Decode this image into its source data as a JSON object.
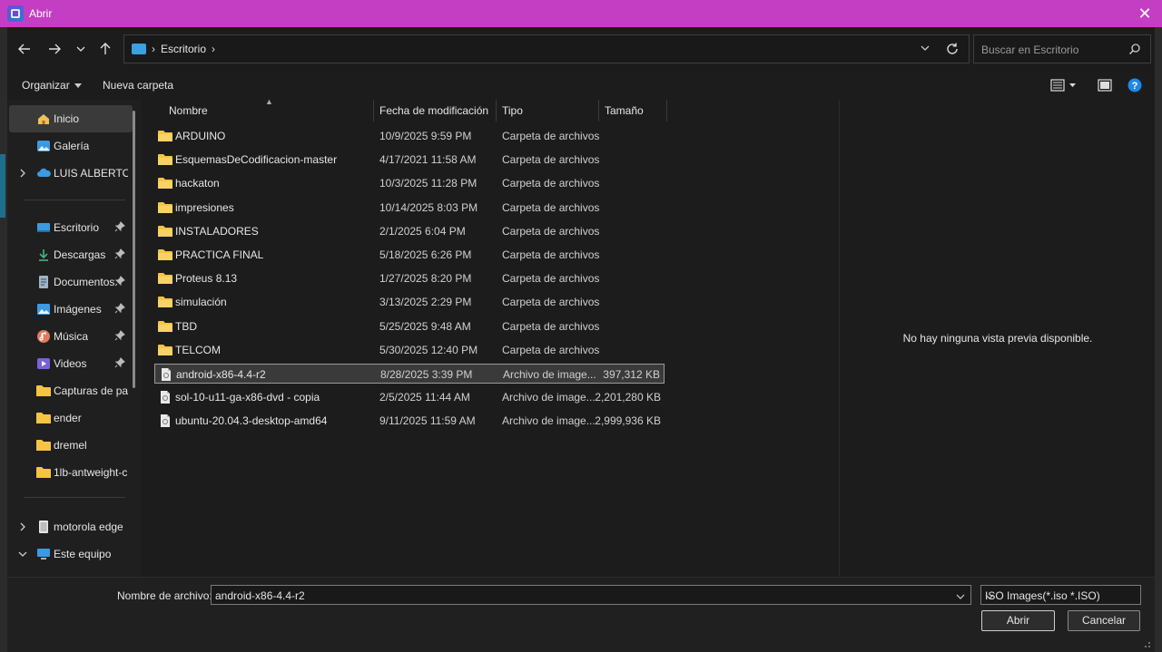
{
  "window": {
    "title": "Abrir"
  },
  "address": {
    "crumbs": [
      "Escritorio"
    ]
  },
  "search": {
    "placeholder": "Buscar en Escritorio"
  },
  "toolbar": {
    "organize_label": "Organizar",
    "new_folder_label": "Nueva carpeta"
  },
  "sidebar": {
    "items": [
      {
        "label": "Inicio",
        "icon": "home-icon"
      },
      {
        "label": "Galería",
        "icon": "gallery-icon"
      },
      {
        "label": "LUIS ALBERTO, I",
        "icon": "cloud-icon"
      },
      {
        "label": "Escritorio",
        "icon": "desktop-icon"
      },
      {
        "label": "Descargas",
        "icon": "download-icon"
      },
      {
        "label": "Documentos",
        "icon": "document-icon"
      },
      {
        "label": "Imágenes",
        "icon": "image-icon"
      },
      {
        "label": "Música",
        "icon": "music-icon"
      },
      {
        "label": "Videos",
        "icon": "video-icon"
      },
      {
        "label": "Capturas de par",
        "icon": "folder-icon"
      },
      {
        "label": "ender",
        "icon": "folder-icon"
      },
      {
        "label": "dremel",
        "icon": "folder-icon"
      },
      {
        "label": "1lb-antweight-c",
        "icon": "folder-icon"
      },
      {
        "label": "motorola edge",
        "icon": "phone-icon"
      },
      {
        "label": "Este equipo",
        "icon": "computer-icon"
      }
    ]
  },
  "columns": {
    "name": "Nombre",
    "date": "Fecha de modificación",
    "type": "Tipo",
    "size": "Tamaño"
  },
  "files": [
    {
      "name": "ARDUINO",
      "date": "10/9/2025 9:59 PM",
      "type": "Carpeta de archivos",
      "size": "",
      "kind": "folder"
    },
    {
      "name": "EsquemasDeCodificacion-master",
      "date": "4/17/2021 11:58 AM",
      "type": "Carpeta de archivos",
      "size": "",
      "kind": "folder"
    },
    {
      "name": "hackaton",
      "date": "10/3/2025 11:28 PM",
      "type": "Carpeta de archivos",
      "size": "",
      "kind": "folder"
    },
    {
      "name": "impresiones",
      "date": "10/14/2025 8:03 PM",
      "type": "Carpeta de archivos",
      "size": "",
      "kind": "folder"
    },
    {
      "name": "INSTALADORES",
      "date": "2/1/2025 6:04 PM",
      "type": "Carpeta de archivos",
      "size": "",
      "kind": "folder"
    },
    {
      "name": "PRACTICA FINAL",
      "date": "5/18/2025 6:26 PM",
      "type": "Carpeta de archivos",
      "size": "",
      "kind": "folder"
    },
    {
      "name": "Proteus 8.13",
      "date": "1/27/2025 8:20 PM",
      "type": "Carpeta de archivos",
      "size": "",
      "kind": "folder"
    },
    {
      "name": "simulación",
      "date": "3/13/2025 2:29 PM",
      "type": "Carpeta de archivos",
      "size": "",
      "kind": "folder"
    },
    {
      "name": "TBD",
      "date": "5/25/2025 9:48 AM",
      "type": "Carpeta de archivos",
      "size": "",
      "kind": "folder"
    },
    {
      "name": "TELCOM",
      "date": "5/30/2025 12:40 PM",
      "type": "Carpeta de archivos",
      "size": "",
      "kind": "folder"
    },
    {
      "name": "android-x86-4.4-r2",
      "date": "8/28/2025 3:39 PM",
      "type": "Archivo de image...",
      "size": "397,312 KB",
      "kind": "file",
      "selected": true
    },
    {
      "name": "sol-10-u11-ga-x86-dvd - copia",
      "date": "2/5/2025 11:44 AM",
      "type": "Archivo de image...",
      "size": "2,201,280 KB",
      "kind": "file"
    },
    {
      "name": "ubuntu-20.04.3-desktop-amd64",
      "date": "9/11/2025 11:59 AM",
      "type": "Archivo de image...",
      "size": "2,999,936 KB",
      "kind": "file"
    }
  ],
  "preview": {
    "message": "No hay ninguna vista previa disponible."
  },
  "bottom": {
    "filename_label": "Nombre de archivo:",
    "filename_value": "android-x86-4.4-r2",
    "filetype_value": "ISO Images(*.iso *.ISO)",
    "open_label": "Abrir",
    "cancel_label": "Cancelar"
  },
  "colors": {
    "titlebar": "#c43ec4",
    "folder": "#f5c445",
    "background": "#1c1c1c",
    "help": "#1e88e5"
  }
}
